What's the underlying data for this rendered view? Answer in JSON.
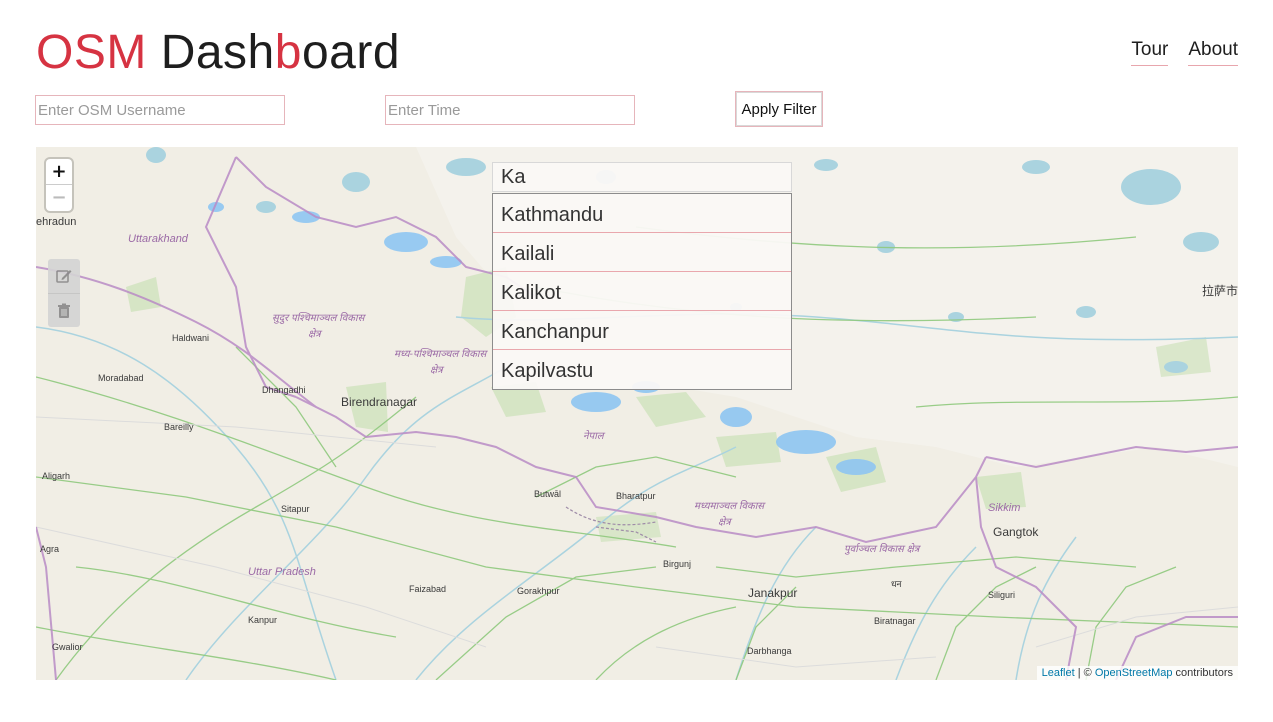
{
  "brand": {
    "part1": "OSM",
    "part2": "Dash",
    "part3": "b",
    "part4": "oard"
  },
  "nav": {
    "tour": "Tour",
    "about": "About"
  },
  "filters": {
    "username_placeholder": "Enter OSM Username",
    "username_value": "",
    "time_placeholder": "Enter Time",
    "time_value": "",
    "apply_label": "Apply Filter"
  },
  "map": {
    "zoom_in": "+",
    "zoom_out": "−",
    "search_value": "Ka",
    "suggestions": [
      "Kathmandu",
      "Kailali",
      "Kalikot",
      "Kanchanpur",
      "Kapilvastu"
    ],
    "labels": {
      "dehradun": "ehradun",
      "uttarakhand": "Uttarakhand",
      "haldwani": "Haldwani",
      "moradabad": "Moradabad",
      "bareilly": "Bareilly",
      "aligarh": "Aligarh",
      "agra": "Agra",
      "gwalior": "Gwalior",
      "kanpur": "Kanpur",
      "sitapur": "Sitapur",
      "uttar_pradesh": "Uttar Pradesh",
      "faizabad": "Faizabad",
      "gorakhpur": "Gorakhpur",
      "dhangadhi": "Dhangadhi",
      "birendranagar": "Birendranagar",
      "butwal": "Butwāl",
      "bharatpur": "Bharatpur",
      "birgunj": "Birgunj",
      "janakpur": "Janakpur",
      "darbhanga": "Darbhanga",
      "biratnagar": "Biratnagar",
      "siliguri": "Siliguri",
      "gangtok": "Gangtok",
      "sikkim": "Sikkim",
      "lhasa": "拉萨市",
      "nepal": "नेपाल",
      "farwest_1": "सुदुर पश्चिमाञ्चल विकास",
      "farwest_2": "क्षेत्र",
      "midwest_1": "मध्य-पश्चिमाञ्चल विकास",
      "midwest_2": "क्षेत्र",
      "central_1": "मध्यमाञ्चल विकास",
      "central_2": "क्षेत्र",
      "eastern": "पुर्वाञ्चल विकास क्षेत्र",
      "dhaka": "धन"
    },
    "attribution": {
      "leaflet": "Leaflet",
      "sep": " | © ",
      "osm": "OpenStreetMap",
      "contrib": " contributors"
    }
  }
}
